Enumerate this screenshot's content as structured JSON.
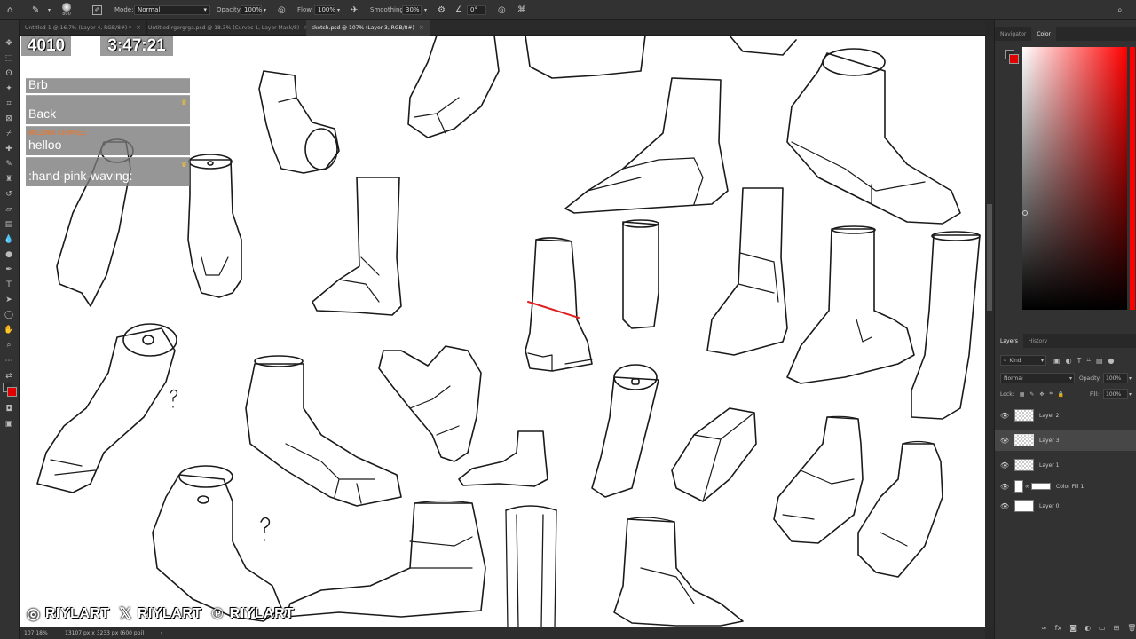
{
  "options_bar": {
    "brush_size": "800",
    "mode_label": "Mode:",
    "mode_value": "Normal",
    "opacity_label": "Opacity:",
    "opacity_value": "100%",
    "flow_label": "Flow:",
    "flow_value": "100%",
    "smoothing_label": "Smoothing:",
    "smoothing_value": "30%",
    "angle_value": "0°"
  },
  "tabs": [
    {
      "label": "Untitled-1 @ 16.7% (Layer 4, RGB/8#) *"
    },
    {
      "label": "Untitled-rgergrga.psd @ 18.3% (Curves 1, Layer Mask/8)"
    },
    {
      "label": "sketch.psd @ 107% (Layer 3, RGB/8#)"
    }
  ],
  "stream": {
    "counter": "4010",
    "timer": "3:47:21",
    "chat": [
      {
        "name": "",
        "name_color": "#7ec850",
        "text": "Brb",
        "crown": false
      },
      {
        "name": "",
        "name_color": "#7ec850",
        "text": "Back",
        "crown": true
      },
      {
        "name": "MELINA CHAVEZ",
        "name_color": "#e07b39",
        "text": "helloo",
        "crown": false
      },
      {
        "name": "",
        "name_color": "#7ec850",
        "text": ":hand-pink-waving:",
        "crown": true
      }
    ],
    "social": [
      {
        "icon": "instagram-icon",
        "glyph": "◎",
        "handle": "RIYLART"
      },
      {
        "icon": "x-icon",
        "glyph": "𝕏",
        "handle": "RIYLART"
      },
      {
        "icon": "patreon-icon",
        "glyph": "℗",
        "handle": "RIYLART"
      }
    ]
  },
  "status_bar": {
    "zoom": "107.18%",
    "doc_info": "13107 px x 3233 px (600 ppi)"
  },
  "panels": {
    "top_tabs": [
      "Navigator",
      "Color"
    ],
    "layer_tabs": [
      "Layers",
      "History"
    ],
    "filter_kind": "Kind",
    "blend_mode": "Normal",
    "opacity_label": "Opacity:",
    "opacity_value": "100%",
    "lock_label": "Lock:",
    "fill_label": "Fill:",
    "fill_value": "100%",
    "layers": [
      {
        "name": "Layer 2",
        "selected": false,
        "thumb": "chk"
      },
      {
        "name": "Layer 3",
        "selected": true,
        "thumb": "chk"
      },
      {
        "name": "Layer 1",
        "selected": false,
        "thumb": "chk"
      },
      {
        "name": "Color Fill 1",
        "selected": false,
        "thumb": "fill"
      },
      {
        "name": "Layer 0",
        "selected": false,
        "thumb": "white"
      }
    ]
  },
  "colors": {
    "foreground": "#2a2a2a",
    "background": "#e00000",
    "accent_red": "#e02020"
  }
}
